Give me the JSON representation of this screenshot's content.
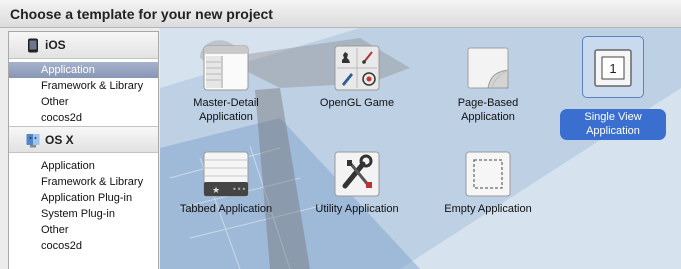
{
  "header": {
    "title": "Choose a template for your new project"
  },
  "sidebar": {
    "ios": {
      "label": "iOS",
      "items": [
        "Application",
        "Framework & Library",
        "Other",
        "cocos2d"
      ]
    },
    "osx": {
      "label": "OS X",
      "items": [
        "Application",
        "Framework & Library",
        "Application Plug-in",
        "System Plug-in",
        "Other",
        "cocos2d"
      ]
    },
    "selected": "Application"
  },
  "templates": [
    {
      "label": "Master-Detail\nApplication",
      "icon": "master-detail-icon"
    },
    {
      "label": "OpenGL Game",
      "icon": "opengl-game-icon"
    },
    {
      "label": "Page-Based\nApplication",
      "icon": "page-based-icon"
    },
    {
      "label": "Single View\nApplication",
      "icon": "single-view-icon",
      "selected": true,
      "icon_text": "1"
    },
    {
      "label": "Tabbed Application",
      "icon": "tabbed-icon"
    },
    {
      "label": "Utility Application",
      "icon": "utility-icon"
    },
    {
      "label": "Empty Application",
      "icon": "empty-icon"
    }
  ],
  "colors": {
    "selection": "#3a6fd0",
    "sidebar_selection": "#8796b6",
    "backdrop": "#c2d3e4"
  }
}
